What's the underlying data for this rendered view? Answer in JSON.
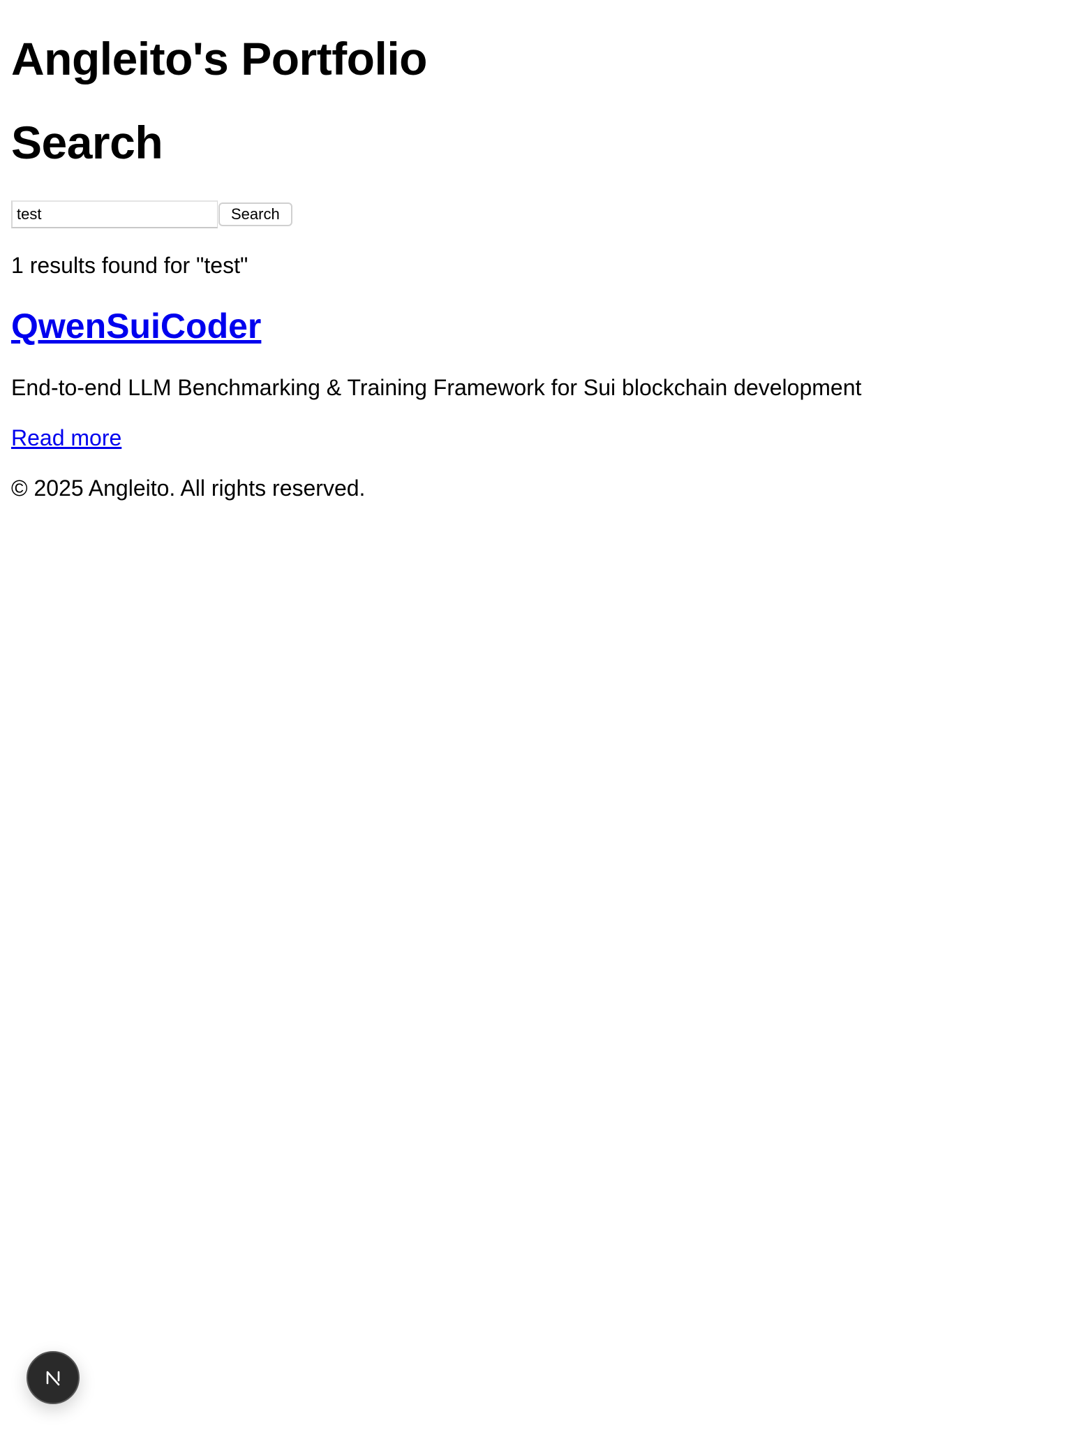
{
  "header": {
    "site_title": "Angleito's Portfolio"
  },
  "search": {
    "page_title": "Search",
    "input_value": "test",
    "button_label": "Search",
    "results_summary": "1 results found for \"test\""
  },
  "results": [
    {
      "title": "QwenSuiCoder",
      "description": "End-to-end LLM Benchmarking & Training Framework for Sui blockchain development",
      "link_label": "Read more"
    }
  ],
  "footer": {
    "copyright": "© 2025 Angleito. All rights reserved."
  },
  "devtools": {
    "badge_icon": "nextjs-logo-icon",
    "badge_color": "#2a2a2a"
  },
  "colors": {
    "link": "#0000ee",
    "text": "#000000",
    "background": "#ffffff"
  }
}
